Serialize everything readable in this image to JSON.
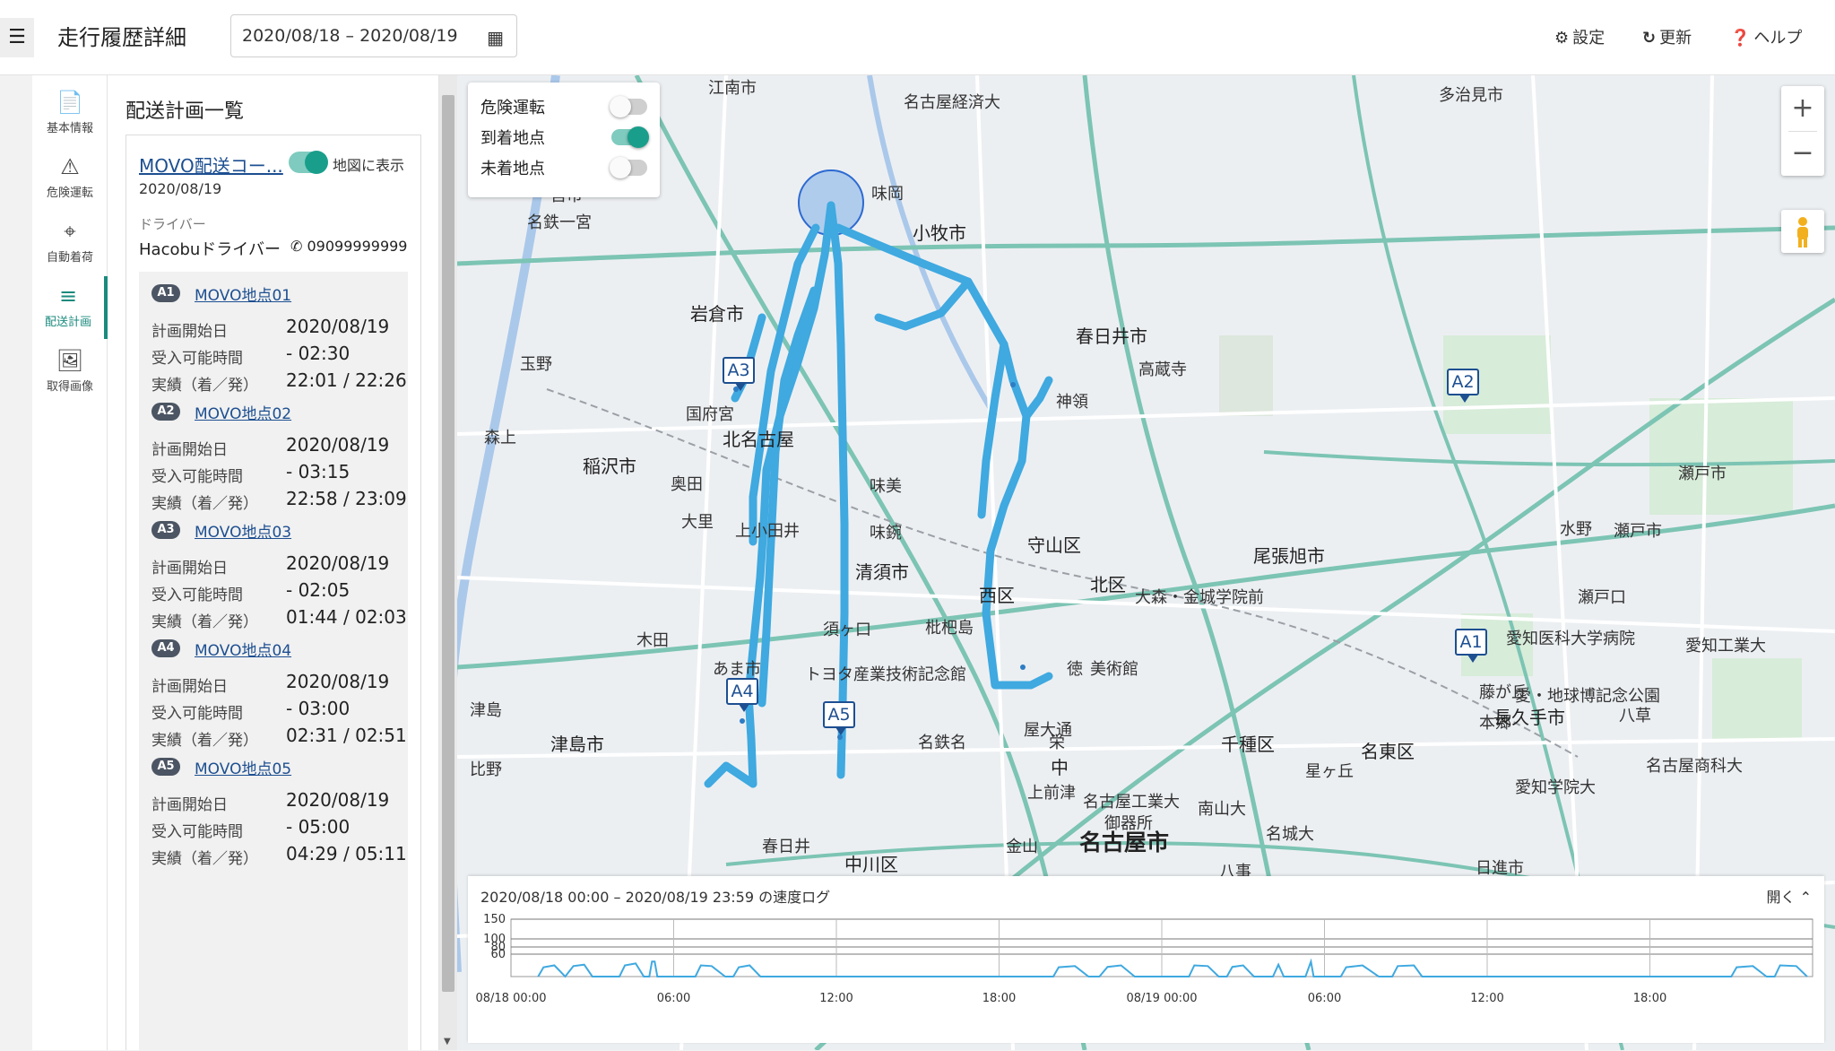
{
  "header": {
    "menu_icon": "☰",
    "title": "走行履歴詳細",
    "date_range": "2020/08/18 – 2020/08/19",
    "calendar_icon": "▦",
    "settings_label": "設定",
    "refresh_label": "更新",
    "help_label": "ヘルプ"
  },
  "nav": [
    {
      "label": "基本情報",
      "icon": "📄"
    },
    {
      "label": "危険運転",
      "icon": "⚠"
    },
    {
      "label": "自動着荷",
      "icon": "⌖"
    },
    {
      "label": "配送計画",
      "icon": "≡"
    },
    {
      "label": "取得画像",
      "icon": "🖼"
    }
  ],
  "panel": {
    "title": "配送計画一覧",
    "course_name": "MOVO配送コー...",
    "show_on_map_label": "地図に表示",
    "course_date": "2020/08/19",
    "driver_label": "ドライバー",
    "driver_name": "Hacobuドライバー",
    "driver_phone": "09099999999",
    "row_labels": {
      "start": "計画開始日",
      "window": "受入可能時間",
      "actual": "実績（着／発）"
    },
    "stops": [
      {
        "badge": "A1",
        "name": "MOVO地点01",
        "start": "2020/08/19",
        "window": "- 02:30",
        "actual": "22:01 / 22:26"
      },
      {
        "badge": "A2",
        "name": "MOVO地点02",
        "start": "2020/08/19",
        "window": "- 03:15",
        "actual": "22:58 / 23:09"
      },
      {
        "badge": "A3",
        "name": "MOVO地点03",
        "start": "2020/08/19",
        "window": "- 02:05",
        "actual": "01:44 / 02:03"
      },
      {
        "badge": "A4",
        "name": "MOVO地点04",
        "start": "2020/08/19",
        "window": "- 03:00",
        "actual": "02:31 / 02:51"
      },
      {
        "badge": "A5",
        "name": "MOVO地点05",
        "start": "2020/08/19",
        "window": "- 05:00",
        "actual": "04:29 / 05:11"
      }
    ]
  },
  "map": {
    "layers": [
      {
        "label": "危険運転",
        "on": false
      },
      {
        "label": "到着地点",
        "on": true
      },
      {
        "label": "未着地点",
        "on": false
      }
    ],
    "zoom_in": "+",
    "zoom_out": "−",
    "markers": [
      "A1",
      "A2",
      "A3",
      "A4",
      "A5"
    ],
    "route_color": "#3fa9e0",
    "place_labels": [
      "江南市",
      "名古屋経済大",
      "多治見市",
      "一宮市",
      "名鉄一宮",
      "味岡",
      "小牧市",
      "岩倉市",
      "春日井市",
      "高蔵寺",
      "玉野",
      "国府宮",
      "北名古屋",
      "神領",
      "森上",
      "稲沢市",
      "奥田",
      "味美",
      "瀬戸市",
      "大里",
      "上小田井",
      "味鋺",
      "守山区",
      "尾張旭市",
      "水野",
      "瀬戸市",
      "清須市",
      "西区",
      "北区",
      "大森・金城学院前",
      "瀬戸口",
      "木田",
      "須ヶ口",
      "枇杷島",
      "愛知医科大学病院",
      "愛知工業大",
      "あま市",
      "トヨタ産業技術記念館",
      "徳",
      "美術館",
      "藤が丘",
      "愛・地球博記念公園",
      "津島",
      "本郷",
      "長久手市",
      "八草",
      "津島市",
      "名鉄名",
      "屋大通",
      "栄",
      "千種区",
      "名東区",
      "星ヶ丘",
      "比野",
      "中",
      "上前津",
      "名古屋工業大",
      "南山大",
      "愛知学院大",
      "名古屋商科大",
      "御器所",
      "名城大",
      "日進市",
      "春日井",
      "中川区",
      "名古屋市",
      "八事",
      "金山"
    ]
  },
  "speed_log": {
    "title": "2020/08/18 00:00 – 2020/08/19 23:59 の速度ログ",
    "open_label": "開く",
    "y_ticks": [
      "150",
      "100",
      "80",
      "60"
    ],
    "x_ticks": [
      "08/18 00:00",
      "06:00",
      "12:00",
      "18:00",
      "08/19 00:00",
      "06:00",
      "12:00",
      "18:00"
    ]
  },
  "chart_data": {
    "type": "area",
    "title": "2020/08/18 00:00 – 2020/08/19 23:59 の速度ログ",
    "xlabel": "",
    "ylabel": "",
    "x_unit": "hours since 2020/08/18 00:00",
    "ylim": [
      0,
      150
    ],
    "y_reference_lines": [
      150,
      100,
      80,
      60
    ],
    "series": [
      {
        "values": [
          [
            1.0,
            0
          ],
          [
            1.2,
            25
          ],
          [
            1.6,
            30
          ],
          [
            2.0,
            0
          ],
          [
            2.3,
            28
          ],
          [
            2.7,
            32
          ],
          [
            3.0,
            0
          ],
          [
            4.0,
            0
          ],
          [
            4.2,
            30
          ],
          [
            4.6,
            35
          ],
          [
            4.9,
            0
          ],
          [
            5.1,
            0
          ],
          [
            5.2,
            40
          ],
          [
            5.3,
            40
          ],
          [
            5.4,
            0
          ],
          [
            6.8,
            0
          ],
          [
            7.0,
            30
          ],
          [
            7.4,
            28
          ],
          [
            7.9,
            0
          ],
          [
            8.2,
            0
          ],
          [
            8.4,
            25
          ],
          [
            8.8,
            30
          ],
          [
            9.2,
            0
          ],
          [
            20.0,
            0
          ],
          [
            20.2,
            25
          ],
          [
            20.8,
            28
          ],
          [
            21.3,
            0
          ],
          [
            21.7,
            0
          ],
          [
            22.0,
            26
          ],
          [
            22.5,
            30
          ],
          [
            23.0,
            0
          ],
          [
            25.0,
            0
          ],
          [
            25.2,
            30
          ],
          [
            25.7,
            28
          ],
          [
            26.1,
            0
          ],
          [
            26.4,
            0
          ],
          [
            26.6,
            26
          ],
          [
            27.0,
            30
          ],
          [
            27.4,
            0
          ],
          [
            28.1,
            0
          ],
          [
            28.3,
            32
          ],
          [
            28.5,
            0
          ],
          [
            29.3,
            0
          ],
          [
            29.5,
            40
          ],
          [
            29.6,
            0
          ],
          [
            30.6,
            0
          ],
          [
            30.8,
            25
          ],
          [
            31.4,
            30
          ],
          [
            32.0,
            0
          ],
          [
            32.5,
            0
          ],
          [
            32.7,
            28
          ],
          [
            33.3,
            30
          ],
          [
            33.6,
            0
          ],
          [
            45.0,
            0
          ],
          [
            45.2,
            25
          ],
          [
            45.8,
            28
          ],
          [
            46.3,
            0
          ],
          [
            46.6,
            0
          ],
          [
            46.8,
            30
          ],
          [
            47.4,
            28
          ],
          [
            47.8,
            0
          ]
        ]
      }
    ]
  }
}
